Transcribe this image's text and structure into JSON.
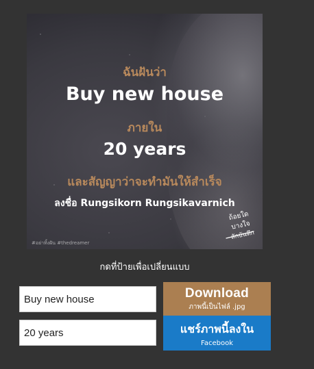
{
  "poster": {
    "line1": "ฉันฝันว่า",
    "dream": "Buy new house",
    "line3": "ภายใน",
    "timeframe": "20 years",
    "line5": "และสัญญาว่าจะทำมันให้สำเร็จ",
    "signature": "ลงชื่อ Rungsikorn Rungsikavarnich",
    "hashtags": "#อย่าทิ้งฝัน #thedreamer",
    "logo_text": [
      "ถ้อยใด",
      "บางใจ",
      "สักบันทึก"
    ],
    "colors": {
      "accent": "#b8895c",
      "text": "#ffffff"
    }
  },
  "hint": "กดที่ป้ายเพื่อเปลี่ยนแบบ",
  "inputs": {
    "dream_value": "Buy new house",
    "years_value": "20 years"
  },
  "buttons": {
    "download_label": "Download",
    "download_sub": "ภาพนี้เป็นไฟล์ .jpg",
    "share_label": "แชร์ภาพนี้ลงใน",
    "share_sub": "Facebook",
    "download_color": "#ab7f51",
    "share_color": "#1a7bc8"
  }
}
